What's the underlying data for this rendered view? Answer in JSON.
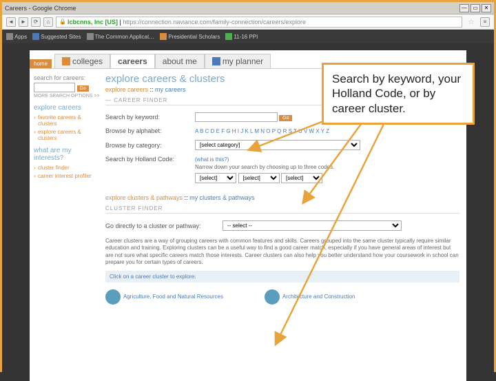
{
  "browser": {
    "title": "Careers - Google Chrome",
    "url_org": "lcbcnns, Inc [US]",
    "url_text": "https://connection.naviance.com/family-connection/careers/explore"
  },
  "bookmarks": {
    "items": [
      "Apps",
      "Suggested Sites",
      "The Common Applicat…",
      "Presidential Scholars",
      "11-16 PPI"
    ]
  },
  "tabs": {
    "home": "home",
    "items": [
      "colleges",
      "careers",
      "about me",
      "my planner"
    ]
  },
  "sidebar": {
    "search_label": "search for careers:",
    "go": "Go",
    "more": "MORE SEARCH OPTIONS >>",
    "explore_title": "explore careers",
    "links1": [
      "favorite careers & clusters",
      "explore careers & clusters"
    ],
    "interests_title": "what are my interests?",
    "links2": [
      "cluster finder",
      "career interest profiler"
    ]
  },
  "content": {
    "title": "explore careers & clusters",
    "bc1": "explore careers",
    "bc_sep": " :: ",
    "bc2": "my careers",
    "sec1": "— CAREER FINDER",
    "rows": {
      "kw": "Search by keyword:",
      "alpha": "Browse by alphabet:",
      "alpha_val": "A B C D E F G H I J K L M N O P Q R S T U V W X Y Z",
      "cat": "Browse by category:",
      "cat_val": "[select category]",
      "hc": "Search by Holland Code:",
      "hc_link": "(what is this?)",
      "hc_narrow": "Narrow down your search by choosing up to three codes.",
      "sel": "[select]",
      "go": "Go"
    },
    "bc3": "explore clusters & pathways",
    "bc4": "my clusters & pathways",
    "sec2": "CLUSTER FINDER",
    "direct_label": "Go directly to a cluster or pathway:",
    "direct_val": "-- select --",
    "desc": "Career clusters are a way of grouping careers with common features and skills. Careers grouped into the same cluster typically require similar education and training. Exploring clusters can be a useful way to find a good career match, especially if you have general areas of interest but are not sure what specific careers match those interests. Career clusters can also help you better understand how your coursework in school can prepare you for certain types of careers.",
    "bluebar": "Click on a career cluster to explore:",
    "clusters": [
      "Agriculture, Food and Natural Resources",
      "Architecture and Construction"
    ]
  },
  "annotation": {
    "text": "Search by keyword, your Holland Code, or by career cluster."
  }
}
